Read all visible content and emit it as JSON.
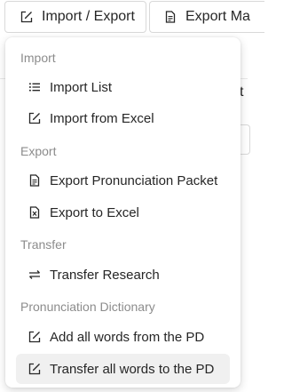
{
  "toolbar": {
    "import_export_label": "Import / Export",
    "import_export_icon": "edit-box-icon",
    "export_label": "Export Ma",
    "export_icon": "document-icon"
  },
  "menu": {
    "groups": [
      {
        "label": "Import",
        "items": [
          {
            "label": "Import List",
            "icon": "list-icon"
          },
          {
            "label": "Import from Excel",
            "icon": "edit-box-icon"
          }
        ]
      },
      {
        "label": "Export",
        "items": [
          {
            "label": "Export Pronunciation Packet",
            "icon": "document-icon"
          },
          {
            "label": "Export to Excel",
            "icon": "excel-file-icon"
          }
        ]
      },
      {
        "label": "Transfer",
        "items": [
          {
            "label": "Transfer Research",
            "icon": "swap-arrows-icon"
          }
        ]
      },
      {
        "label": "Pronunciation Dictionary",
        "items": [
          {
            "label": "Add all words from the PD",
            "icon": "edit-box-icon"
          },
          {
            "label": "Transfer all words to the PD",
            "icon": "edit-box-icon",
            "hovered": true
          }
        ]
      }
    ]
  },
  "background": {
    "partial_letter": "t"
  }
}
